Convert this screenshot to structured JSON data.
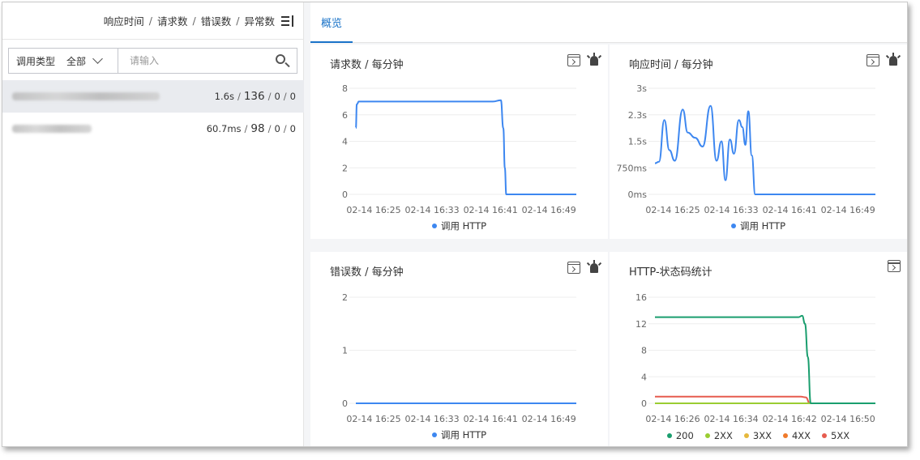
{
  "sort_bar": {
    "items": [
      "响应时间",
      "请求数",
      "错误数",
      "异常数"
    ],
    "separator": "/"
  },
  "filter": {
    "type_label": "调用类型",
    "type_value": "全部",
    "search_placeholder": "请输入"
  },
  "services": [
    {
      "name_redacted": true,
      "rt": "1.6s",
      "requests": "136",
      "errors": "0",
      "exceptions": "0",
      "selected": true
    },
    {
      "name_redacted": true,
      "rt": "60.7ms",
      "requests": "98",
      "errors": "0",
      "exceptions": "0",
      "selected": false
    }
  ],
  "tabs": [
    {
      "label": "概览",
      "active": true
    }
  ],
  "colors": {
    "accent": "#1a73c8",
    "series_blue": "#3d87f0",
    "s200": "#1a9e6e",
    "s2xx": "#9acd32",
    "s3xx": "#e6b83c",
    "s4xx": "#f07a2a",
    "s5xx": "#e65c4f"
  },
  "chart_data": [
    {
      "id": "requests",
      "type": "line",
      "title": "请求数 / 每分钟",
      "y_ticks": [
        "0",
        "2",
        "4",
        "6",
        "8"
      ],
      "ylim": [
        0,
        8
      ],
      "x_ticks": [
        "02-14 16:25",
        "02-14 16:33",
        "02-14 16:41",
        "02-14 16:49"
      ],
      "series": [
        {
          "name": "调用 HTTP",
          "color": "#3d87f0",
          "points": [
            [
              16.4,
              5
            ],
            [
              16.6,
              6.8
            ],
            [
              17,
              7
            ],
            [
              18,
              7
            ],
            [
              20,
              7
            ],
            [
              24,
              7
            ],
            [
              28,
              7
            ],
            [
              32,
              7
            ],
            [
              36,
              7
            ],
            [
              40,
              7
            ],
            [
              44,
              7
            ],
            [
              45.6,
              7.1
            ],
            [
              46.1,
              5
            ],
            [
              46.4,
              2
            ],
            [
              46.7,
              0
            ],
            [
              48,
              0
            ],
            [
              52,
              0
            ],
            [
              56,
              0
            ],
            [
              60.8,
              0
            ]
          ]
        }
      ],
      "grid": true,
      "legend": "bottom"
    },
    {
      "id": "response_time",
      "type": "line",
      "title": "响应时间 / 每分钟",
      "y_ticks": [
        "0ms",
        "750ms",
        "1.5s",
        "2.3s",
        "3s"
      ],
      "ylim": [
        0,
        3
      ],
      "x_ticks": [
        "02-14 16:25",
        "02-14 16:33",
        "02-14 16:41",
        "02-14 16:49"
      ],
      "series": [
        {
          "name": "调用 HTTP",
          "color": "#3d87f0",
          "points": [
            [
              16.4,
              0.88
            ],
            [
              17.2,
              0.92
            ],
            [
              18.3,
              2.1
            ],
            [
              19.3,
              1.25
            ],
            [
              20.4,
              0.95
            ],
            [
              22,
              2.4
            ],
            [
              23,
              1.75
            ],
            [
              24.5,
              1.6
            ],
            [
              26,
              1.35
            ],
            [
              27.6,
              2.5
            ],
            [
              28.8,
              0.95
            ],
            [
              29.8,
              1.5
            ],
            [
              30.6,
              0.4
            ],
            [
              31.5,
              1.55
            ],
            [
              32.3,
              1.15
            ],
            [
              33.3,
              2.1
            ],
            [
              34,
              1.9
            ],
            [
              34.6,
              1.4
            ],
            [
              35.2,
              2.35
            ],
            [
              35.9,
              1.1
            ],
            [
              36.6,
              0
            ],
            [
              40,
              0
            ],
            [
              48,
              0
            ],
            [
              60.8,
              0
            ]
          ]
        }
      ],
      "grid": true,
      "legend": "bottom"
    },
    {
      "id": "errors",
      "type": "line",
      "title": "错误数 / 每分钟",
      "y_ticks": [
        "0",
        "1",
        "2"
      ],
      "ylim": [
        0,
        2
      ],
      "x_ticks": [
        "02-14 16:25",
        "02-14 16:33",
        "02-14 16:41",
        "02-14 16:49"
      ],
      "series": [
        {
          "name": "调用 HTTP",
          "color": "#3d87f0",
          "points": [
            [
              16.4,
              0
            ],
            [
              60.8,
              0
            ]
          ]
        }
      ],
      "grid": true,
      "legend": "bottom"
    },
    {
      "id": "status_codes",
      "type": "line",
      "title": "HTTP-状态码统计",
      "y_ticks": [
        "0",
        "4",
        "8",
        "12",
        "16"
      ],
      "ylim": [
        0,
        16
      ],
      "x_ticks": [
        "02-14 16:26",
        "02-14 16:34",
        "02-14 16:42",
        "02-14 16:50"
      ],
      "series": [
        {
          "name": "200",
          "color": "#1a9e6e",
          "points": [
            [
              26,
              13
            ],
            [
              30,
              13
            ],
            [
              36,
              13
            ],
            [
              42,
              13
            ],
            [
              46.2,
              13
            ],
            [
              46.7,
              13.2
            ],
            [
              47.1,
              12
            ],
            [
              47.5,
              7
            ],
            [
              47.9,
              0
            ],
            [
              50,
              0
            ],
            [
              57,
              0
            ]
          ]
        },
        {
          "name": "2XX",
          "color": "#9acd32",
          "points": [
            [
              26,
              0
            ],
            [
              57,
              0
            ]
          ]
        },
        {
          "name": "3XX",
          "color": "#e6b83c",
          "points": [
            [
              26,
              0
            ],
            [
              57,
              0
            ]
          ]
        },
        {
          "name": "4XX",
          "color": "#f07a2a",
          "points": [
            [
              26,
              0
            ],
            [
              57,
              0
            ]
          ]
        },
        {
          "name": "5XX",
          "color": "#e65c4f",
          "points": [
            [
              26,
              1
            ],
            [
              30,
              1
            ],
            [
              36,
              1
            ],
            [
              42,
              1
            ],
            [
              46.5,
              1
            ],
            [
              47.2,
              0.9
            ],
            [
              47.8,
              0
            ],
            [
              57,
              0
            ]
          ]
        }
      ],
      "grid": true,
      "legend": "bottom"
    }
  ]
}
